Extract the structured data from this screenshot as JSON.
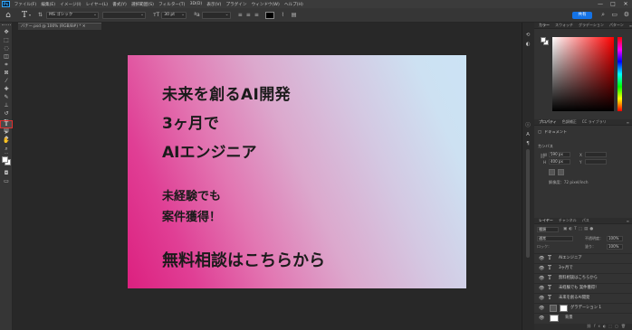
{
  "app": {
    "logo": "Ps"
  },
  "menu": [
    "ファイル(F)",
    "編集(E)",
    "イメージ(I)",
    "レイヤー(L)",
    "書式(Y)",
    "選択範囲(S)",
    "フィルター(T)",
    "3D(D)",
    "表示(V)",
    "プラグイン",
    "ウィンドウ(W)",
    "ヘルプ(H)"
  ],
  "window_controls": {
    "minimize": "—",
    "maximize": "□",
    "close": "✕"
  },
  "options": {
    "tool_glyph": "T",
    "font_family": "MS ゴシック",
    "font_style": "",
    "font_size": "30 pt",
    "antialias": "",
    "share_label": "共有",
    "text_color": "#000000"
  },
  "document": {
    "tab_title": "バナー.psd @ 100% (RGB/8#) *  ✕"
  },
  "artboard": {
    "lines": [
      "未来を創るAI開発",
      "3ヶ月で",
      "AIエンジニア",
      "未経験でも",
      "案件獲得！",
      "無料相談はこちらから"
    ]
  },
  "panels": {
    "color_tabs": [
      "カラー",
      "スウォッチ",
      "グラデーション",
      "パターン"
    ],
    "properties_tabs": [
      "プロパティ",
      "色調補正",
      "CC ライブラリ"
    ],
    "properties": {
      "doc_label": "ドキュメント",
      "section": "カンバス",
      "w_label": "W",
      "w_value": "590 px",
      "h_label": "H",
      "h_value": "400 px",
      "x_label": "X",
      "y_label": "Y",
      "resolution": "解像度：72 pixel/inch"
    },
    "layers_tabs": [
      "レイヤー",
      "チャンネル",
      "パス"
    ],
    "layers_controls": {
      "filter": "種類",
      "mode": "通常",
      "opacity_label": "不透明度：",
      "opacity": "100%",
      "lock_label": "ロック：",
      "fill_label": "塗り：",
      "fill": "100%"
    },
    "layers": [
      {
        "name": "AIエンジニア",
        "type": "text"
      },
      {
        "name": "3ヶ月で",
        "type": "text"
      },
      {
        "name": "無料相談はこちらから",
        "type": "text"
      },
      {
        "name": "未経験でも 案件獲得！",
        "type": "text"
      },
      {
        "name": "未来を創るAI開発",
        "type": "text"
      },
      {
        "name": "グラデーション 1",
        "type": "fill"
      },
      {
        "name": "背景",
        "type": "background"
      }
    ]
  }
}
